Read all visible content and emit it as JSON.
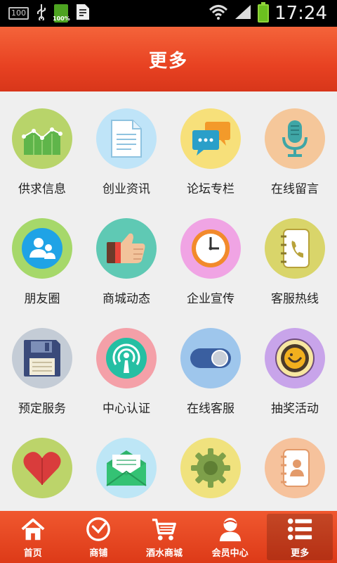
{
  "status_bar": {
    "box_label": "100",
    "battery_small_label": "100%",
    "time": "17:24"
  },
  "header": {
    "title": "更多"
  },
  "grid": {
    "items": [
      {
        "label": "供求信息",
        "icon": "chart-icon",
        "bg": "#b8d46a"
      },
      {
        "label": "创业资讯",
        "icon": "document-icon",
        "bg": "#bfe4f8"
      },
      {
        "label": "论坛专栏",
        "icon": "chat-bubbles-icon",
        "bg": "#f7e07a"
      },
      {
        "label": "在线留言",
        "icon": "microphone-icon",
        "bg": "#f5c79a"
      },
      {
        "label": "朋友圈",
        "icon": "people-icon",
        "bg": "#a6d86a"
      },
      {
        "label": "商城动态",
        "icon": "thumbs-up-icon",
        "bg": "#5fc9b4"
      },
      {
        "label": "企业宣传",
        "icon": "clock-icon",
        "bg": "#f0a4e4"
      },
      {
        "label": "客服热线",
        "icon": "phonebook-icon",
        "bg": "#d9d56a"
      },
      {
        "label": "预定服务",
        "icon": "floppy-disk-icon",
        "bg": "#c4ccd6"
      },
      {
        "label": "中心认证",
        "icon": "broadcast-user-icon",
        "bg": "#f4a0a8"
      },
      {
        "label": "在线客服",
        "icon": "toggle-switch-icon",
        "bg": "#9ec6ec"
      },
      {
        "label": "抽奖活动",
        "icon": "lottery-icon",
        "bg": "#c8a4ea"
      },
      {
        "label": "",
        "icon": "heart-icon",
        "bg": "#bcd46a"
      },
      {
        "label": "",
        "icon": "envelope-icon",
        "bg": "#bde6f6"
      },
      {
        "label": "",
        "icon": "gear-icon",
        "bg": "#f0e27e"
      },
      {
        "label": "",
        "icon": "contacts-icon",
        "bg": "#f6c29c"
      }
    ]
  },
  "tabbar": {
    "tabs": [
      {
        "label": "首页",
        "icon": "home-icon",
        "active": false
      },
      {
        "label": "商铺",
        "icon": "clock-icon",
        "active": false
      },
      {
        "label": "酒水商城",
        "icon": "cart-icon",
        "active": false
      },
      {
        "label": "会员中心",
        "icon": "user-icon",
        "active": false
      },
      {
        "label": "更多",
        "icon": "list-icon",
        "active": true
      }
    ]
  }
}
